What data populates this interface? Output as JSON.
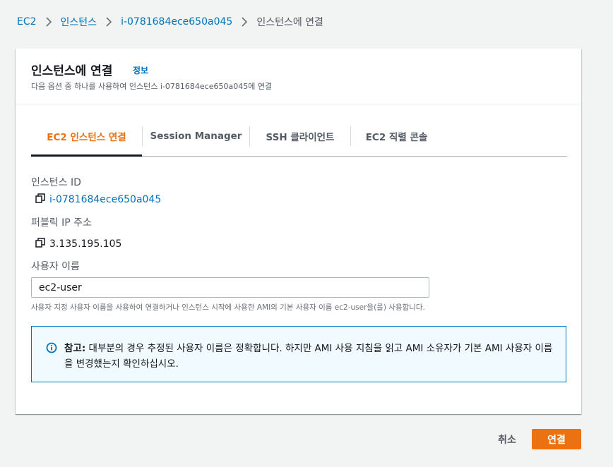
{
  "breadcrumb": {
    "items": [
      "EC2",
      "인스턴스",
      "i-0781684ece650a045"
    ],
    "current": "인스턴스에 연결"
  },
  "panel": {
    "title": "인스턴스에 연결",
    "info_link": "정보",
    "description": "다음 옵션 중 하나를 사용하여 인스턴스 i-0781684ece650a045에 연결"
  },
  "tabs": [
    {
      "label": "EC2 인스턴스 연결",
      "active": true
    },
    {
      "label": "Session Manager",
      "active": false
    },
    {
      "label": "SSH 클라이언트",
      "active": false
    },
    {
      "label": "EC2 직렬 콘솔",
      "active": false
    }
  ],
  "instance": {
    "label": "인스턴스 ID",
    "value": "i-0781684ece650a045"
  },
  "public_ip": {
    "label": "퍼블릭 IP 주소",
    "value": "3.135.195.105"
  },
  "username": {
    "label": "사용자 이름",
    "value": "ec2-user",
    "hint": "사용자 지정 사용자 이름을 사용하여 연결하거나 인스턴스 시작에 사용한 AMI의 기본 사용자 이름 ec2-user을(를) 사용합니다."
  },
  "alert": {
    "bold": "참고:",
    "text": " 대부분의 경우 추정된 사용자 이름은 정확합니다. 하지만 AMI 사용 지침을 읽고 AMI 소유자가 기본 AMI 사용자 이름을 변경했는지 확인하십시오."
  },
  "footer": {
    "cancel_label": "취소",
    "connect_label": "연결"
  },
  "colors": {
    "accent": "#ec7211",
    "link": "#0073bb",
    "alert_bg": "#f1faff"
  },
  "icons": {
    "breadcrumb_separator": "chevron-right-icon",
    "copy": "copy-icon",
    "info": "info-icon"
  }
}
